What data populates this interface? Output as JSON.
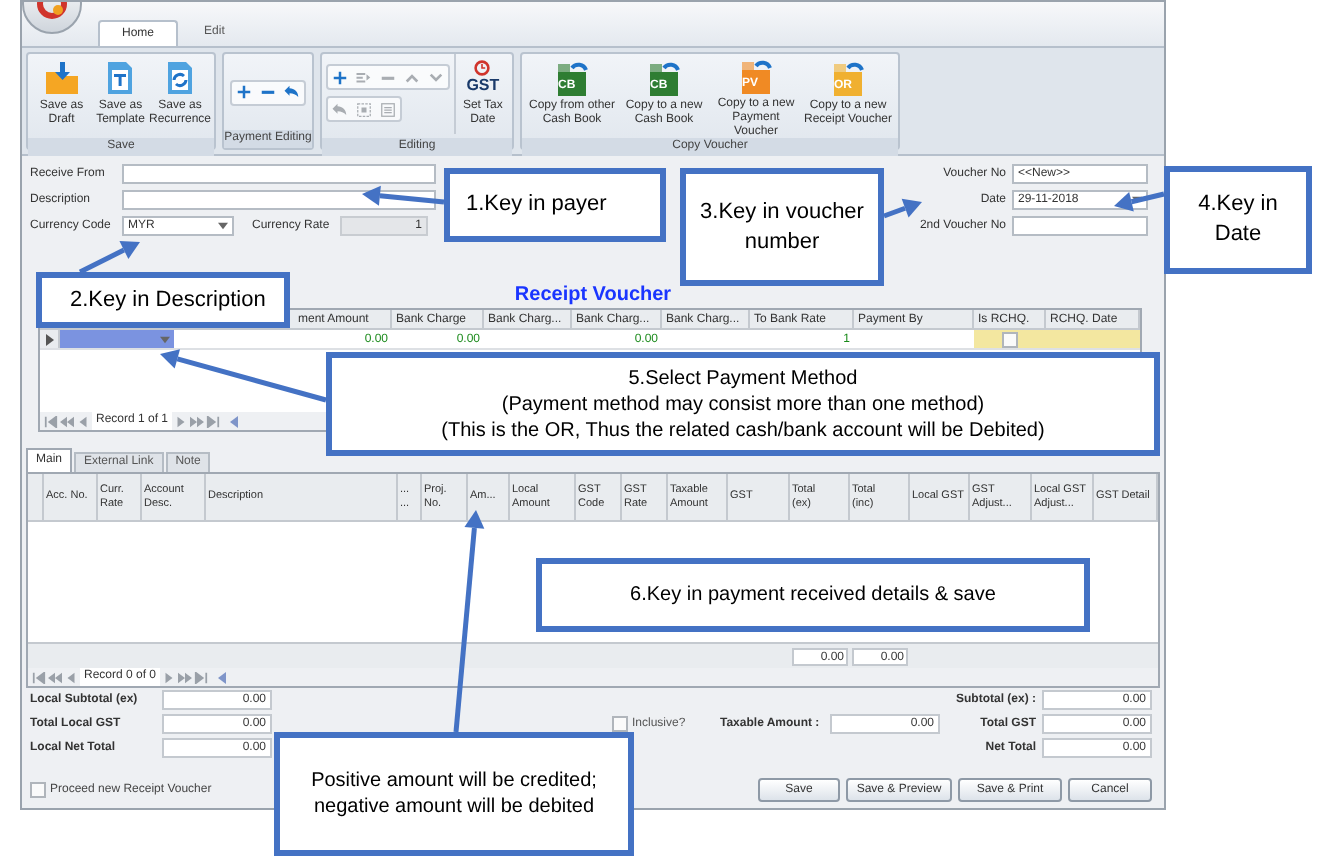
{
  "ribbon": {
    "tabs": [
      {
        "label": "Home",
        "selected": true
      },
      {
        "label": "Edit",
        "selected": false
      }
    ],
    "groups": [
      {
        "label": "Save",
        "kind": "large",
        "buttons": [
          {
            "label": "Save as\nDraft"
          },
          {
            "label": "Save as\nTemplate"
          },
          {
            "label": "Save as\nRecurrence"
          }
        ]
      },
      {
        "label": "Payment Editing",
        "kind": "tools",
        "tools": [
          {
            "disabled": false
          },
          {
            "disabled": false
          },
          {
            "disabled": false
          }
        ]
      },
      {
        "label": "Editing",
        "kind": "tools_and_large",
        "tools": [
          {
            "disabled": false
          },
          {
            "disabled": true
          },
          {
            "disabled": true
          },
          {
            "disabled": true
          },
          {
            "disabled": true
          },
          {
            "disabled": true
          },
          {
            "disabled": true
          },
          {
            "disabled": true
          }
        ],
        "buttons": [
          {
            "label": "Set Tax\nDate",
            "icon_text": "GST"
          }
        ]
      },
      {
        "label": "Copy Voucher",
        "kind": "large",
        "buttons": [
          {
            "label": "Copy from other\nCash Book",
            "icon_text": "CB"
          },
          {
            "label": "Copy to a new\nCash Book",
            "icon_text": "CB"
          },
          {
            "label": "Copy to a new\nPayment Voucher",
            "icon_text": "PV"
          },
          {
            "label": "Copy to a new\nReceipt Voucher",
            "icon_text": "OR"
          }
        ]
      }
    ]
  },
  "form": {
    "left_fields": [
      {
        "label": "Receive From",
        "kind": "text",
        "disabled": false
      },
      {
        "label": "Description",
        "kind": "text",
        "disabled": false
      },
      {
        "label": "Currency Code",
        "kind": "dropdown",
        "value": "MYR",
        "disabled": false
      },
      {
        "label": "Currency Rate",
        "kind": "text",
        "value": "1",
        "disabled": true
      }
    ],
    "right_fields": [
      {
        "label": "Voucher No",
        "kind": "text",
        "value": "<<New>>"
      },
      {
        "label": "Date",
        "kind": "dropdown",
        "value": "29-11-2018"
      },
      {
        "label": "2nd Voucher No",
        "kind": "text"
      }
    ]
  },
  "section_title": "Receipt Voucher",
  "payment_grid": {
    "columns": [
      "ment Amount",
      "Bank Charge",
      "Bank Charg...",
      "Bank Charg...",
      "Bank Charg...",
      "To Bank Rate",
      "Payment By",
      "Is RCHQ.",
      "RCHQ. Date"
    ],
    "rows": [
      {
        "cells": {
          "ment_amount": "0.00",
          "bank_charge": "0.00",
          "bank_charg_2": "0.00",
          "to_bank_rate": "1"
        },
        "is_rchq": false
      }
    ],
    "navigator": "Record 1 of 1"
  },
  "detail_tabs": [
    {
      "label": "Main",
      "selected": true
    },
    {
      "label": "External Link",
      "selected": false
    },
    {
      "label": "Note",
      "selected": false
    }
  ],
  "detail_grid": {
    "columns": [
      "Acc. No.",
      "Curr.\nRate",
      "Account\nDesc.",
      "Description",
      "...\n...",
      "Proj.\nNo.",
      "Am...",
      "Local\nAmount",
      "GST\nCode",
      "GST\nRate",
      "Taxable\nAmount",
      "GST",
      "Total\n(ex)",
      "Total\n(inc)",
      "Local GST",
      "GST\nAdjust...",
      "Local GST\nAdjust...",
      "GST Detail"
    ],
    "footer": {
      "total_ex": "0.00",
      "total_inc": "0.00"
    },
    "navigator": "Record 0 of 0"
  },
  "totals": {
    "left": [
      {
        "label": "Local Subtotal (ex)",
        "value": "0.00"
      },
      {
        "label": "Total Local GST",
        "value": "0.00"
      },
      {
        "label": "Local Net Total",
        "value": "0.00"
      }
    ],
    "inclusive": {
      "label": "Inclusive?",
      "checked": false
    },
    "taxable": {
      "label": "Taxable Amount :",
      "value": "0.00"
    },
    "right": [
      {
        "label": "Subtotal (ex) :",
        "value": "0.00"
      },
      {
        "label": "Total GST",
        "value": "0.00"
      },
      {
        "label": "Net Total",
        "value": "0.00"
      }
    ]
  },
  "proceed": {
    "label": "Proceed new Receipt Voucher",
    "checked": false
  },
  "buttons": [
    "Save",
    "Save & Preview",
    "Save & Print",
    "Cancel"
  ],
  "callouts": [
    {
      "lines": [
        "1.Key in payer"
      ]
    },
    {
      "lines": [
        "2.Key in Description"
      ]
    },
    {
      "lines": [
        "3.Key in voucher number"
      ]
    },
    {
      "lines": [
        "4.Key in Date"
      ]
    },
    {
      "lines": [
        "5.Select Payment Method",
        "(Payment method may consist more than one method)",
        "(This is the OR, Thus the related cash/bank account will be Debited)"
      ]
    },
    {
      "lines": [
        "6.Key in payment received details & save"
      ]
    },
    {
      "lines": [
        "Positive amount will be credited; negative amount will be debited"
      ]
    }
  ]
}
